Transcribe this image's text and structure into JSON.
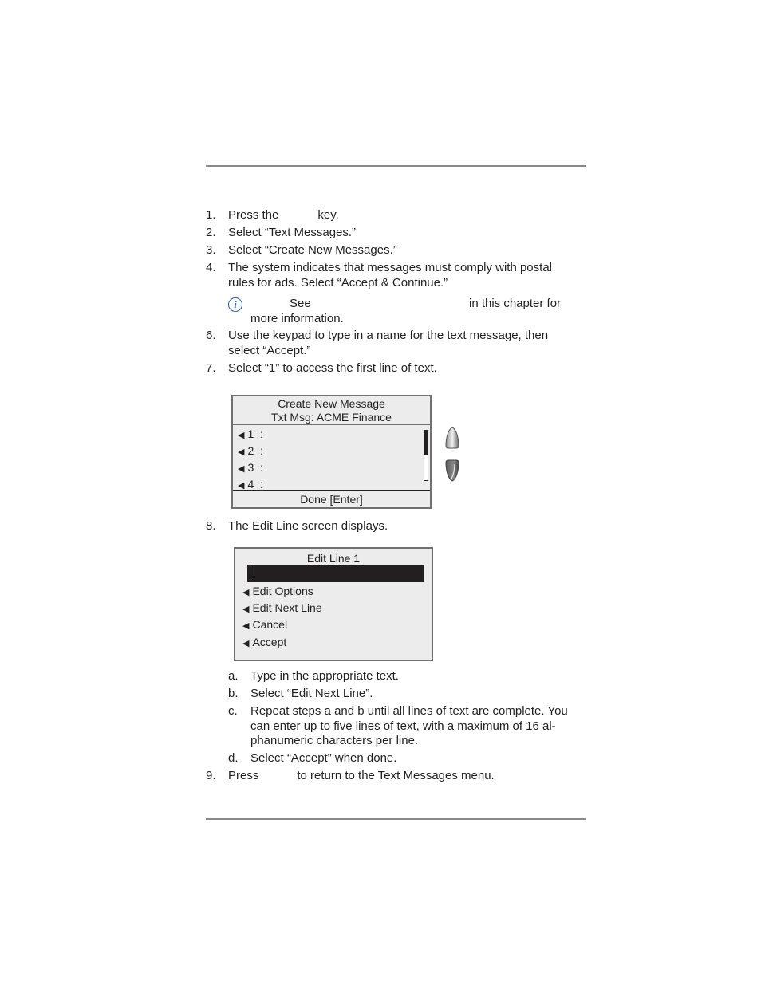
{
  "steps": [
    {
      "num": "1.",
      "text_before": "Press the",
      "text_after": "key."
    },
    {
      "num": "2.",
      "text": "Select “Text Messages.”"
    },
    {
      "num": "3.",
      "text": "Select “Create New Messages.”"
    },
    {
      "num": "4.",
      "line1": "The system indicates that messages must comply with postal",
      "line2": "rules for ads. Select “Accept & Continue.”"
    },
    {
      "num": "6.",
      "line1": "Use the keypad to type in a name for the text message, then",
      "line2": "select “Accept.”"
    },
    {
      "num": "7.",
      "text": "Select “1” to access the first line of text."
    },
    {
      "num": "8.",
      "text": "The Edit Line screen displays."
    },
    {
      "num": "9.",
      "text_before": "Press",
      "text_after": "to return to the Text Messages menu."
    }
  ],
  "note": {
    "icon": "info-icon",
    "see": "See",
    "mid": "in this chapter for",
    "end": "more information."
  },
  "screen1": {
    "title": "Create New Message",
    "subtitle": "Txt Msg:  ACME Finance",
    "rows": [
      {
        "arrow": "◀",
        "label": "1  :"
      },
      {
        "arrow": "◀",
        "label": "2  :"
      },
      {
        "arrow": "◀",
        "label": "3  :"
      },
      {
        "arrow": "◀",
        "label": "4  :"
      }
    ],
    "scroll_position_fraction": 0.5,
    "footer": "Done [Enter]",
    "keys": [
      "up-arrow-key-icon",
      "down-arrow-key-icon"
    ]
  },
  "screen2": {
    "title": "Edit Line 1",
    "input_value": "",
    "options": [
      {
        "arrow": "◀",
        "label": "Edit Options"
      },
      {
        "arrow": "◀",
        "label": "Edit Next Line"
      },
      {
        "arrow": "◀",
        "label": "Cancel"
      },
      {
        "arrow": "◀",
        "label": "Accept"
      }
    ]
  },
  "substeps": [
    {
      "num": "a.",
      "text": "Type in the appropriate text."
    },
    {
      "num": "b.",
      "text": "Select “Edit Next Line”."
    },
    {
      "num": "c.",
      "line1": "Repeat steps a and b until all lines of text are complete. You",
      "line2": "can enter up to five lines of text, with a maximum of 16 al-",
      "line3": "phanumeric characters per line."
    },
    {
      "num": "d.",
      "text": "Select “Accept” when done."
    }
  ]
}
